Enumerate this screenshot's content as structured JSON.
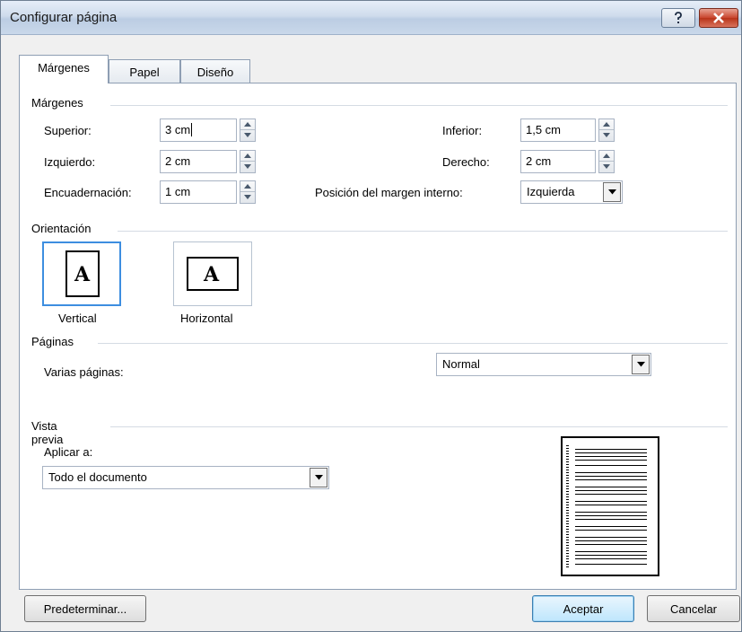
{
  "window": {
    "title": "Configurar página"
  },
  "tabs": [
    {
      "label": "Márgenes",
      "active": true
    },
    {
      "label": "Papel",
      "active": false
    },
    {
      "label": "Diseño",
      "active": false
    }
  ],
  "margins": {
    "section_label": "Márgenes",
    "superior": {
      "label": "Superior:",
      "value": "3 cm"
    },
    "izquierdo": {
      "label": "Izquierdo:",
      "value": "2 cm"
    },
    "encuadernacion": {
      "label": "Encuadernación:",
      "value": "1 cm"
    },
    "inferior": {
      "label": "Inferior:",
      "value": "1,5 cm"
    },
    "derecho": {
      "label": "Derecho:",
      "value": "2 cm"
    },
    "posicion": {
      "label": "Posición del margen interno:",
      "value": "Izquierda"
    }
  },
  "orientation": {
    "section_label": "Orientación",
    "vertical": {
      "label": "Vertical",
      "glyph": "A",
      "selected": true
    },
    "horizontal": {
      "label": "Horizontal",
      "glyph": "A",
      "selected": false
    }
  },
  "pages": {
    "section_label": "Páginas",
    "multiple_label": "Varias páginas:",
    "multiple_value": "Normal"
  },
  "preview": {
    "section_label": "Vista previa",
    "apply_label": "Aplicar a:",
    "apply_value": "Todo el documento"
  },
  "buttons": {
    "default_label": "Predeterminar...",
    "ok_label": "Aceptar",
    "cancel_label": "Cancelar"
  },
  "colors": {
    "selection_border": "#3d8ee0",
    "close_button": "#c8442c",
    "title_bar": "#cfdcec"
  },
  "icons": {
    "help": "question-mark-icon",
    "close": "close-x-icon",
    "spin": "spin-arrows-icon",
    "dropdown": "chevron-down-icon"
  }
}
